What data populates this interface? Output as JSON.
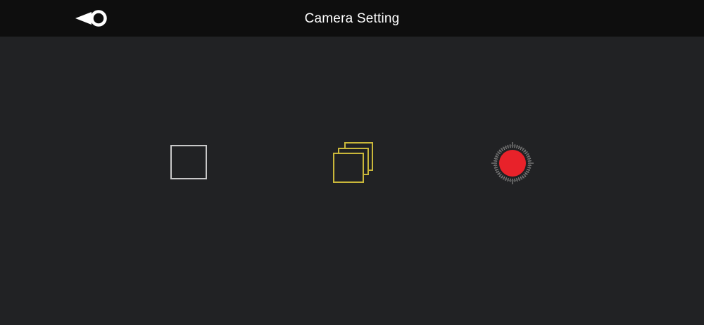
{
  "header": {
    "title": "Camera Setting",
    "back_icon": "back-arrow-circle-icon"
  },
  "modes": [
    {
      "id": "single",
      "icon": "single-shot-icon",
      "selected": false,
      "color": "#c8c8c8"
    },
    {
      "id": "burst",
      "icon": "burst-shot-icon",
      "selected": true,
      "color": "#c9b73a"
    },
    {
      "id": "record",
      "icon": "video-record-icon",
      "selected": false,
      "color": "#e8222a"
    }
  ],
  "colors": {
    "background": "#212224",
    "header_background": "#0e0e0e",
    "selected_accent": "#c9b73a",
    "record_red": "#e8222a"
  }
}
